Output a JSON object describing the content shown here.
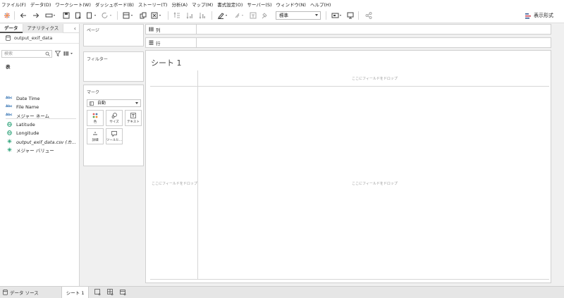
{
  "menu": [
    "ファイル(F)",
    "データ(D)",
    "ワークシート(W)",
    "ダッシュボード(B)",
    "ストーリー(T)",
    "分析(A)",
    "マップ(M)",
    "書式設定(O)",
    "サーバー(S)",
    "ウィンドウ(N)",
    "ヘルプ(H)"
  ],
  "toolbar": {
    "format_select": "標準",
    "show_me": "表示形式",
    "icons": [
      "tableau-logo-icon",
      "undo-icon",
      "redo-icon",
      "replay-icon",
      "save-icon",
      "new-datasource-icon",
      "pause-update-icon",
      "refresh-icon",
      "new-worksheet-icon",
      "duplicate-icon",
      "clear-icon",
      "swap-icon",
      "sort-asc-icon",
      "sort-desc-icon",
      "highlight-icon",
      "group-icon",
      "label-icon",
      "fix-axes-icon",
      "fit-icon",
      "presentation-icon",
      "share-icon"
    ]
  },
  "datapane": {
    "tab_data": "データ",
    "tab_analytics": "アナリティクス",
    "collapse": "‹",
    "datasource": "output_exif_data",
    "search_placeholder": "検索",
    "section_table": "表",
    "fields": [
      {
        "type": "Abc",
        "name": "Date Time"
      },
      {
        "type": "Abc",
        "name": "File Name"
      },
      {
        "type": "Abc",
        "name": "メジャー ネーム"
      },
      {
        "type": "geo",
        "name": "Latitude"
      },
      {
        "type": "geo",
        "name": "Longitude"
      },
      {
        "type": "measure",
        "name": "output_exif_data.csv (カ..."
      },
      {
        "type": "measure",
        "name": "メジャー バリュー"
      }
    ]
  },
  "cards": {
    "pages": "ページ",
    "filters": "フィルター",
    "marks": "マーク",
    "mark_type": "自動",
    "buttons": [
      {
        "name": "color",
        "label": "色"
      },
      {
        "name": "size",
        "label": "サイズ"
      },
      {
        "name": "text",
        "label": "テキスト"
      },
      {
        "name": "detail",
        "label": "詳細"
      },
      {
        "name": "tooltip",
        "label": "ツールヒ..."
      }
    ]
  },
  "shelves": {
    "columns": "列",
    "rows": "行"
  },
  "sheet": {
    "title": "シート 1",
    "drop_top": "ここにフィールドをドロップ",
    "drop_left": "ここにフィールドをドロップ",
    "drop_center": "ここにフィールドをドロップ"
  },
  "bottom": {
    "datasource_tab": "データ ソース",
    "sheet_tab": "シート 1"
  },
  "colors": {
    "accent_blue": "#2b6cb0",
    "field_green": "#2ea37a",
    "logo_orange": "#e8762d"
  }
}
